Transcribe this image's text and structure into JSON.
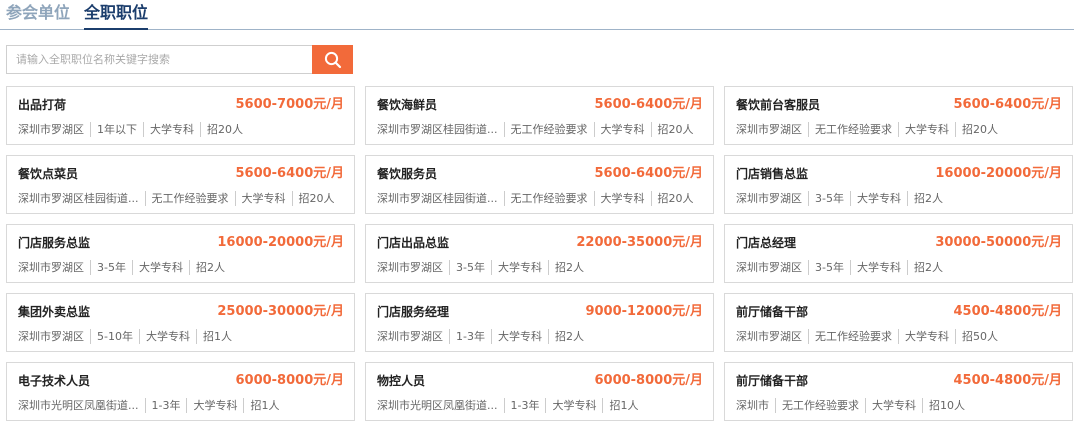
{
  "tabs": [
    {
      "label": "参会单位",
      "active": false
    },
    {
      "label": "全职职位",
      "active": true
    }
  ],
  "search": {
    "placeholder": "请输入全职职位名称关键字搜索",
    "icon": "search-icon"
  },
  "colors": {
    "accent": "#f26a3a",
    "active_tab": "#1b3d6c",
    "inactive_tab": "#8fa5bb"
  },
  "jobs": [
    {
      "title": "出品打荷",
      "salary": "5600-7000元/月",
      "location": "深圳市罗湖区",
      "experience": "1年以下",
      "education": "大学专科",
      "headcount": "招20人"
    },
    {
      "title": "餐饮海鲜员",
      "salary": "5600-6400元/月",
      "location": "深圳市罗湖区桂园街道...",
      "experience": "无工作经验要求",
      "education": "大学专科",
      "headcount": "招20人"
    },
    {
      "title": "餐饮前台客服员",
      "salary": "5600-6400元/月",
      "location": "深圳市罗湖区",
      "experience": "无工作经验要求",
      "education": "大学专科",
      "headcount": "招20人"
    },
    {
      "title": "餐饮点菜员",
      "salary": "5600-6400元/月",
      "location": "深圳市罗湖区桂园街道...",
      "experience": "无工作经验要求",
      "education": "大学专科",
      "headcount": "招20人"
    },
    {
      "title": "餐饮服务员",
      "salary": "5600-6400元/月",
      "location": "深圳市罗湖区桂园街道...",
      "experience": "无工作经验要求",
      "education": "大学专科",
      "headcount": "招20人"
    },
    {
      "title": "门店销售总监",
      "salary": "16000-20000元/月",
      "location": "深圳市罗湖区",
      "experience": "3-5年",
      "education": "大学专科",
      "headcount": "招2人"
    },
    {
      "title": "门店服务总监",
      "salary": "16000-20000元/月",
      "location": "深圳市罗湖区",
      "experience": "3-5年",
      "education": "大学专科",
      "headcount": "招2人"
    },
    {
      "title": "门店出品总监",
      "salary": "22000-35000元/月",
      "location": "深圳市罗湖区",
      "experience": "3-5年",
      "education": "大学专科",
      "headcount": "招2人"
    },
    {
      "title": "门店总经理",
      "salary": "30000-50000元/月",
      "location": "深圳市罗湖区",
      "experience": "3-5年",
      "education": "大学专科",
      "headcount": "招2人"
    },
    {
      "title": "集团外卖总监",
      "salary": "25000-30000元/月",
      "location": "深圳市罗湖区",
      "experience": "5-10年",
      "education": "大学专科",
      "headcount": "招1人"
    },
    {
      "title": "门店服务经理",
      "salary": "9000-12000元/月",
      "location": "深圳市罗湖区",
      "experience": "1-3年",
      "education": "大学专科",
      "headcount": "招2人"
    },
    {
      "title": "前厅储备干部",
      "salary": "4500-4800元/月",
      "location": "深圳市罗湖区",
      "experience": "无工作经验要求",
      "education": "大学专科",
      "headcount": "招50人"
    },
    {
      "title": "电子技术人员",
      "salary": "6000-8000元/月",
      "location": "深圳市光明区凤凰街道...",
      "experience": "1-3年",
      "education": "大学专科",
      "headcount": "招1人"
    },
    {
      "title": "物控人员",
      "salary": "6000-8000元/月",
      "location": "深圳市光明区凤凰街道...",
      "experience": "1-3年",
      "education": "大学专科",
      "headcount": "招1人"
    },
    {
      "title": "前厅储备干部",
      "salary": "4500-4800元/月",
      "location": "深圳市",
      "experience": "无工作经验要求",
      "education": "大学专科",
      "headcount": "招10人"
    }
  ]
}
